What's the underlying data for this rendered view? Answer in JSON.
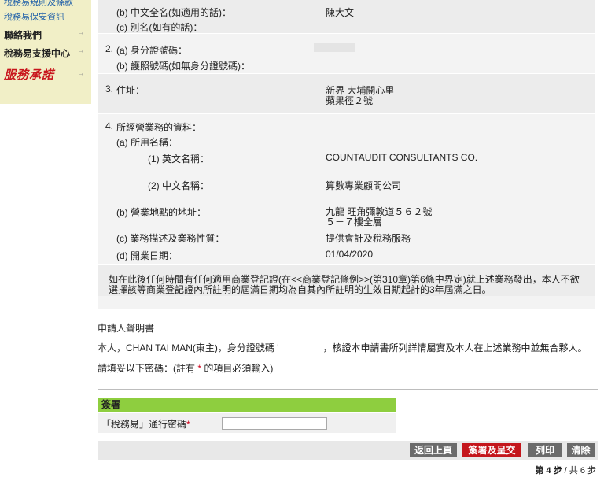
{
  "sidebar": {
    "items": [
      {
        "label": "稅務易規則及條款"
      },
      {
        "label": "稅務易保安資訊"
      },
      {
        "label": "聯絡我們",
        "arrow": "→"
      },
      {
        "label": "稅務易支援中心",
        "arrow": "→"
      },
      {
        "label": "服務承諾",
        "arrow": "→"
      }
    ]
  },
  "form": {
    "q1b_label": "(b) 中文全名(如適用的話)：",
    "q1b_value": "陳大文",
    "q1c_label": "(c) 別名(如有的話)：",
    "q2_num": "2.",
    "q2a_label": "(a) 身分證號碼：",
    "q2b_label": "(b) 護照號碼(如無身分證號碼)：",
    "q3_num": "3.",
    "q3_label": "住址：",
    "q3_value_line1": "新界 大埔開心里",
    "q3_value_line2": "蘋果徑２號",
    "q4_num": "4.",
    "q4_label": "所經營業務的資料：",
    "q4a_label": "(a) 所用名稱：",
    "q4a1_label": "(1) 英文名稱：",
    "q4a1_value": "COUNTAUDIT CONSULTANTS CO.",
    "q4a2_label": "(2) 中文名稱：",
    "q4a2_value": "算數專業顧問公司",
    "q4b_label": "(b) 營業地點的地址：",
    "q4b_value_line1": "九龍 旺角彌敦道５６２號",
    "q4b_value_line2": "５－７樓全層",
    "q4c_label": "(c) 業務描述及業務性質：",
    "q4c_value": "提供會計及稅務服務",
    "q4d_label": "(d) 開業日期：",
    "q4d_value": "01/04/2020",
    "note_line1": "如在此後任何時間有任何適用商業登記證(在<<商業登記條例>>(第310章)第6條中界定)就上述業務發出，本人不欲",
    "note_line2": "選擇該等商業登記證內所註明的屆滿日期均為自其內所註明的生效日期起計的3年屆滿之日。"
  },
  "declaration": {
    "title": "申請人聲明書",
    "statement_part1": "本人，CHAN TAI MAN(東主)，身分證號碼 '",
    "statement_part2": "，核證本申請書所列詳情屬實及本人在上述業務中並無合夥人。",
    "instruction_part1": "請填妥以下密碼：(註有",
    "instruction_star": "*",
    "instruction_part2": "的項目必須輸入)"
  },
  "sign": {
    "heading": "簽署",
    "password_label": "「稅務易」通行密碼",
    "password_star": "*",
    "password_value": ""
  },
  "buttons": {
    "back": "返回上頁",
    "sign_submit": "簽署及呈交",
    "print": "列印",
    "clear": "清除"
  },
  "step_indicator": {
    "current": "第 4 步",
    "total": "/ 共 6 步"
  },
  "colors": {
    "sidebar_bg": "#f1efc7",
    "sign_header": "#8ece3f",
    "primary_button": "#c4161c",
    "secondary_button": "#6b6b6b",
    "required_star": "#d0021b"
  }
}
